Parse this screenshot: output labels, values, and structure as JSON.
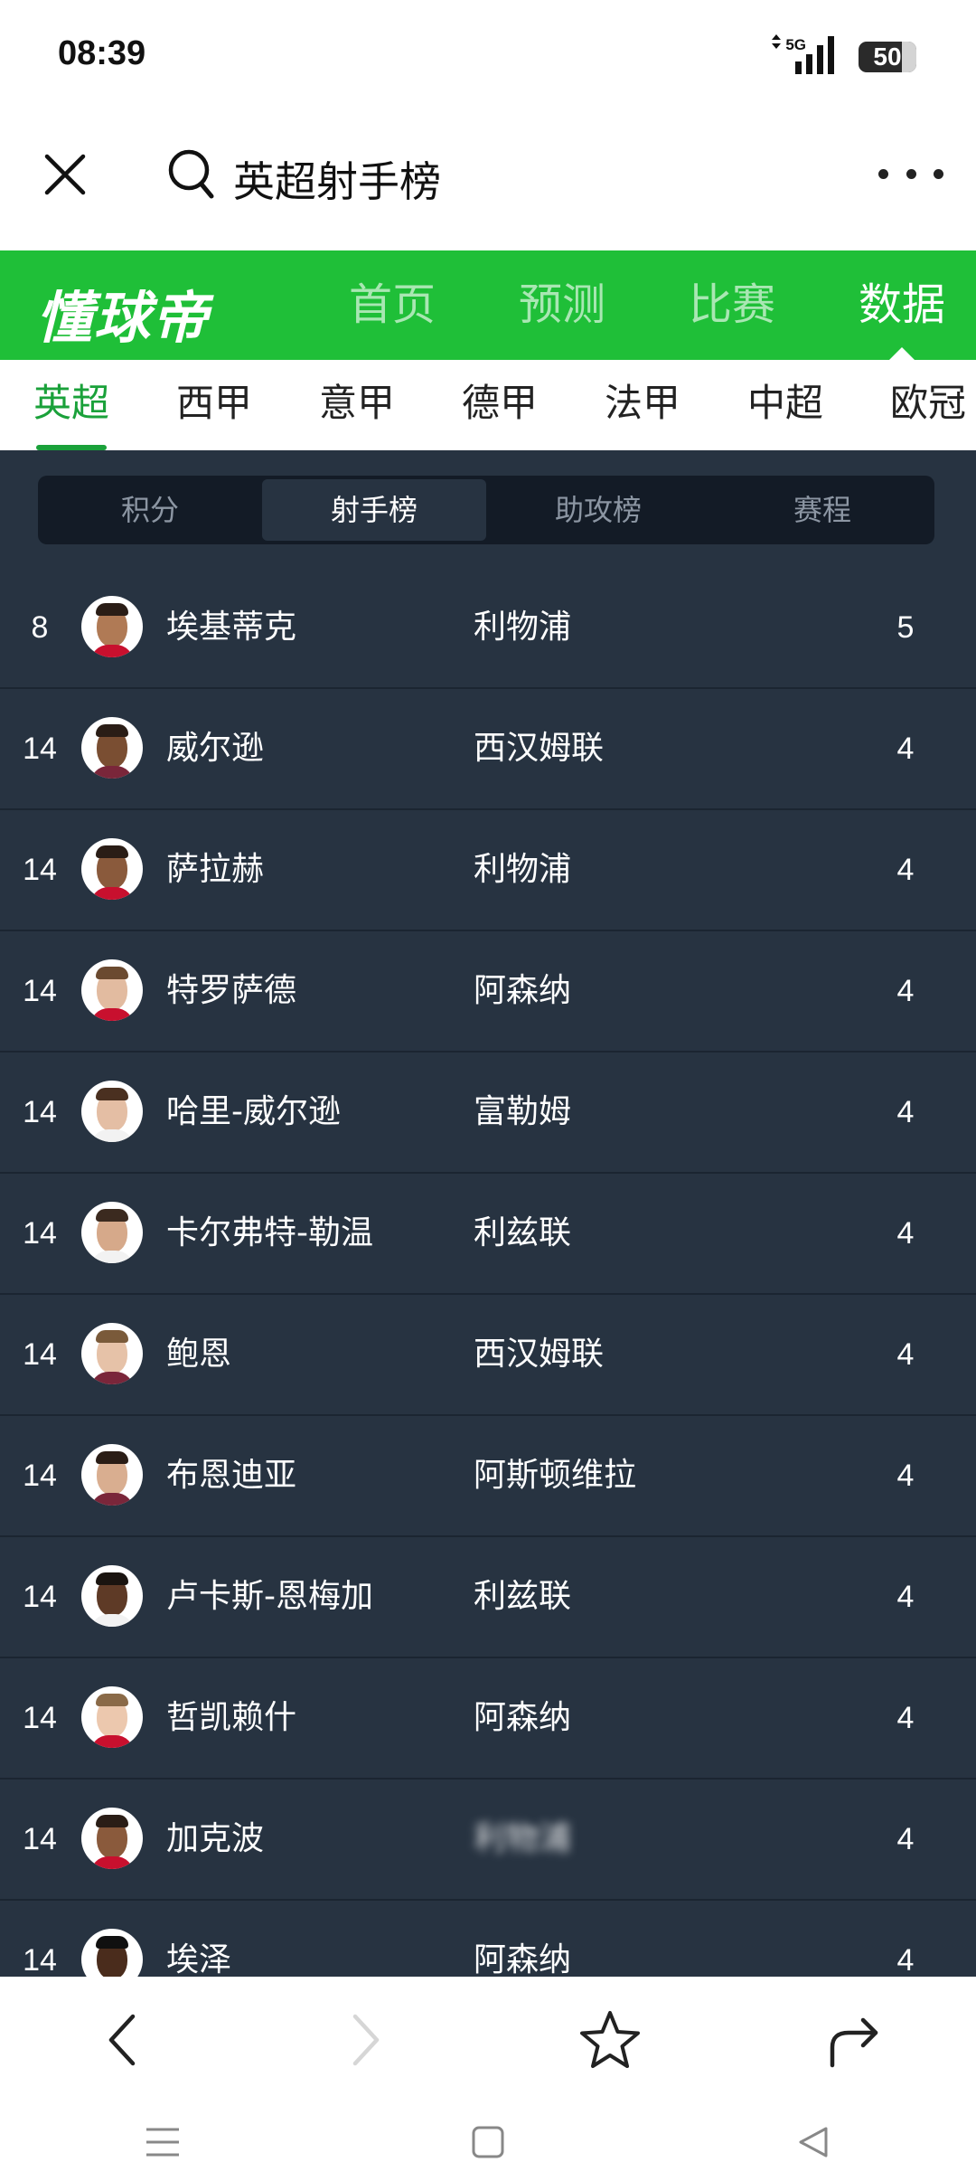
{
  "status_bar": {
    "time": "08:39",
    "network": "5G",
    "battery": "50"
  },
  "search": {
    "query": "英超射手榜"
  },
  "brand": {
    "logo": "懂球帝",
    "nav": [
      {
        "label": "首页"
      },
      {
        "label": "预测"
      },
      {
        "label": "比赛"
      },
      {
        "label": "数据"
      }
    ],
    "active_nav": "数据"
  },
  "leagues": [
    {
      "label": "英超"
    },
    {
      "label": "西甲"
    },
    {
      "label": "意甲"
    },
    {
      "label": "德甲"
    },
    {
      "label": "法甲"
    },
    {
      "label": "中超"
    },
    {
      "label": "欧冠"
    }
  ],
  "active_league": "英超",
  "segments": [
    {
      "label": "积分"
    },
    {
      "label": "射手榜"
    },
    {
      "label": "助攻榜"
    },
    {
      "label": "赛程"
    }
  ],
  "active_segment": "射手榜",
  "scorers": [
    {
      "rank": "8",
      "name": "埃基蒂克",
      "team": "利物浦",
      "goals": "5"
    },
    {
      "rank": "14",
      "name": "威尔逊",
      "team": "西汉姆联",
      "goals": "4"
    },
    {
      "rank": "14",
      "name": "萨拉赫",
      "team": "利物浦",
      "goals": "4"
    },
    {
      "rank": "14",
      "name": "特罗萨德",
      "team": "阿森纳",
      "goals": "4"
    },
    {
      "rank": "14",
      "name": "哈里-威尔逊",
      "team": "富勒姆",
      "goals": "4"
    },
    {
      "rank": "14",
      "name": "卡尔弗特-勒温",
      "team": "利兹联",
      "goals": "4"
    },
    {
      "rank": "14",
      "name": "鲍恩",
      "team": "西汉姆联",
      "goals": "4"
    },
    {
      "rank": "14",
      "name": "布恩迪亚",
      "team": "阿斯顿维拉",
      "goals": "4"
    },
    {
      "rank": "14",
      "name": "卢卡斯-恩梅加",
      "team": "利兹联",
      "goals": "4"
    },
    {
      "rank": "14",
      "name": "哲凯赖什",
      "team": "阿森纳",
      "goals": "4"
    },
    {
      "rank": "14",
      "name": "加克波",
      "team": "利物浦",
      "goals": "4"
    },
    {
      "rank": "14",
      "name": "埃泽",
      "team": "阿森纳",
      "goals": "4"
    }
  ],
  "colors": {
    "brand_green": "#1fbf38",
    "active_tab_green": "#1aa13a",
    "table_bg": "#273341",
    "segment_bg": "#131b26"
  },
  "icons": {
    "close": "close-icon",
    "search": "search-icon",
    "more": "more-icon",
    "back": "chevron-left-icon",
    "forward": "chevron-right-icon",
    "favorite": "star-icon",
    "share": "share-icon",
    "sys_menu": "menu-icon",
    "sys_home": "square-icon",
    "sys_back": "triangle-back-icon"
  }
}
